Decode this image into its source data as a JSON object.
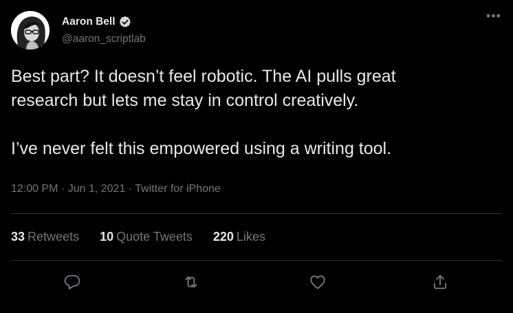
{
  "author": {
    "display_name": "Aaron Bell",
    "handle": "@aaron_scriptlab",
    "verified": true
  },
  "tweet": {
    "text": "Best part? It doesn’t feel robotic. The AI pulls great\nresearch but lets me stay in control creatively.\n\nI’ve never felt this empowered using a writing tool.",
    "time": "12:00 PM",
    "separator": "·",
    "date": "Jun 1, 2021",
    "source": "Twitter for iPhone"
  },
  "stats": {
    "retweets_count": "33",
    "retweets_label": "Retweets",
    "quote_count": "10",
    "quote_label": "Quote Tweets",
    "likes_count": "220",
    "likes_label": "Likes"
  },
  "icons": {
    "more": "more-icon",
    "verified": "verified-badge-icon",
    "reply": "reply-icon",
    "retweet": "retweet-icon",
    "like": "like-icon",
    "share": "share-icon"
  },
  "colors": {
    "background": "#000000",
    "text_primary": "#e7e9ea",
    "text_secondary": "#71767b",
    "divider": "#2f3336"
  }
}
